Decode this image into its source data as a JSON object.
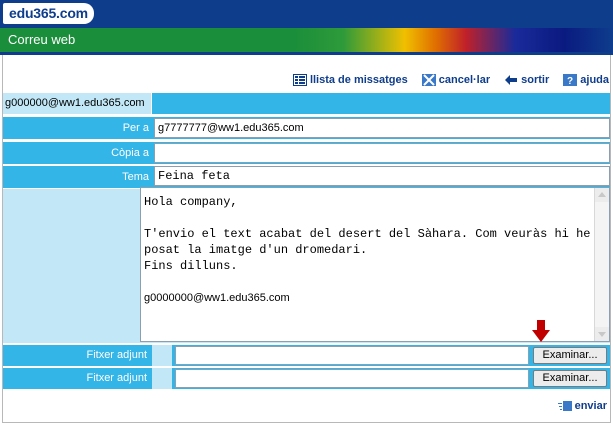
{
  "brand": {
    "logo_text": "edu365.com"
  },
  "app": {
    "title": "Correu web"
  },
  "toolbar": {
    "items": [
      {
        "label": "llista de missatges",
        "icon": "list-icon"
      },
      {
        "label": "cancel·lar",
        "icon": "cancel-icon"
      },
      {
        "label": "sortir",
        "icon": "exit-arrow-icon"
      },
      {
        "label": "ajuda",
        "icon": "help-icon"
      }
    ]
  },
  "sender": "g000000@ww1.edu365.com",
  "form": {
    "to_label": "Per a",
    "to_value": "g7777777@ww1.edu365.com",
    "cc_label": "Còpia a",
    "cc_value": "",
    "subject_label": "Tema",
    "subject_value": "Feina feta",
    "body": {
      "line1": "Hola company,",
      "line2": "T'envio el text acabat del desert del Sàhara. Com veuràs hi he",
      "line3": "posat la imatge d'un dromedari.",
      "line4": "Fins dilluns.",
      "signature": "g0000000@ww1.edu365.com"
    },
    "attachments": [
      {
        "label": "Fitxer adjunt",
        "value": "",
        "button": "Examinar..."
      },
      {
        "label": "Fitxer adjunt",
        "value": "",
        "button": "Examinar..."
      }
    ],
    "send_label": "enviar"
  },
  "colors": {
    "brand_blue": "#0e3d8c",
    "row_blue": "#33b5e8",
    "row_pale": "#c2e8f7",
    "arrow_red": "#c00000"
  }
}
